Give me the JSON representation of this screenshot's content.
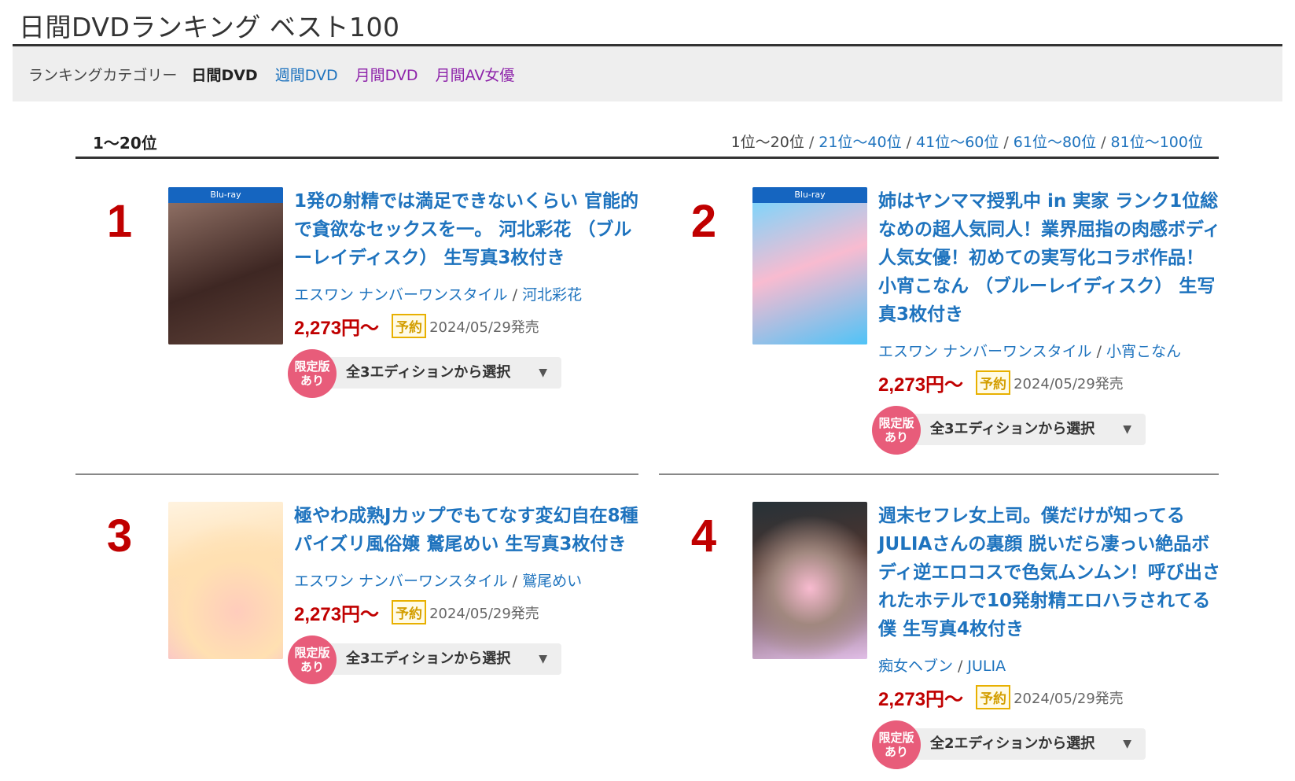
{
  "page": {
    "title": "日間DVDランキング ベスト100"
  },
  "category": {
    "label": "ランキングカテゴリー",
    "current": "日間DVD",
    "links": [
      "週間DVD",
      "月間DVD",
      "月間AV女優"
    ]
  },
  "range": {
    "current": "1〜20位",
    "pager_current": "1位〜20位",
    "pager_links": [
      "21位〜40位",
      "41位〜60位",
      "61位〜80位",
      "81位〜100位"
    ],
    "separator": "/"
  },
  "items": [
    {
      "rank": "1",
      "title": "1発の射精では満足できないくらい 官能的で貪欲なセックスを一。 河北彩花 （ブルーレイディスク） 生写真3枚付き",
      "maker": "エスワン ナンバーワンスタイル",
      "actress": "河北彩花",
      "price": "2,273円〜",
      "status": "予約",
      "release": "2024/05/29発売",
      "badge_line1": "限定版",
      "badge_line2": "あり",
      "edition": "全3エディションから選択",
      "cover_icon": "bluray-cover-image",
      "bd_strip": "Blu-ray"
    },
    {
      "rank": "2",
      "title": "姉はヤンママ授乳中 in 実家 ランク1位総なめの超人気同人！業界屈指の肉感ボディ人気女優！初めての実写化コラボ作品！ 小宵こなん （ブルーレイディスク） 生写真3枚付き",
      "maker": "エスワン ナンバーワンスタイル",
      "actress": "小宵こなん",
      "price": "2,273円〜",
      "status": "予約",
      "release": "2024/05/29発売",
      "badge_line1": "限定版",
      "badge_line2": "あり",
      "edition": "全3エディションから選択",
      "cover_icon": "bluray-cover-image",
      "bd_strip": "Blu-ray"
    },
    {
      "rank": "3",
      "title": "極やわ成熟Jカップでもてなす変幻自在8種パイズリ風俗嬢 鷲尾めい 生写真3枚付き",
      "maker": "エスワン ナンバーワンスタイル",
      "actress": "鷲尾めい",
      "price": "2,273円〜",
      "status": "予約",
      "release": "2024/05/29発売",
      "badge_line1": "限定版",
      "badge_line2": "あり",
      "edition": "全3エディションから選択",
      "cover_icon": "dvd-cover-image"
    },
    {
      "rank": "4",
      "title": "週末セフレ女上司。僕だけが知ってるJULIAさんの裏顔 脱いだら凄っい絶品ボディ逆エロコスで色気ムンムン！呼び出されたホテルで10発射精エロハラされてる僕 生写真4枚付き",
      "maker": "痴女ヘブン",
      "actress": "JULIA",
      "price": "2,273円〜",
      "status": "予約",
      "release": "2024/05/29発売",
      "badge_line1": "限定版",
      "badge_line2": "あり",
      "edition": "全2エディションから選択",
      "cover_icon": "dvd-cover-image"
    }
  ],
  "colors": {
    "link": "#1e73be",
    "rank": "#c00000",
    "price": "#c00000",
    "badge": "#e85c7a",
    "reserve_border": "#e8b000",
    "visited": "#8e24aa"
  }
}
